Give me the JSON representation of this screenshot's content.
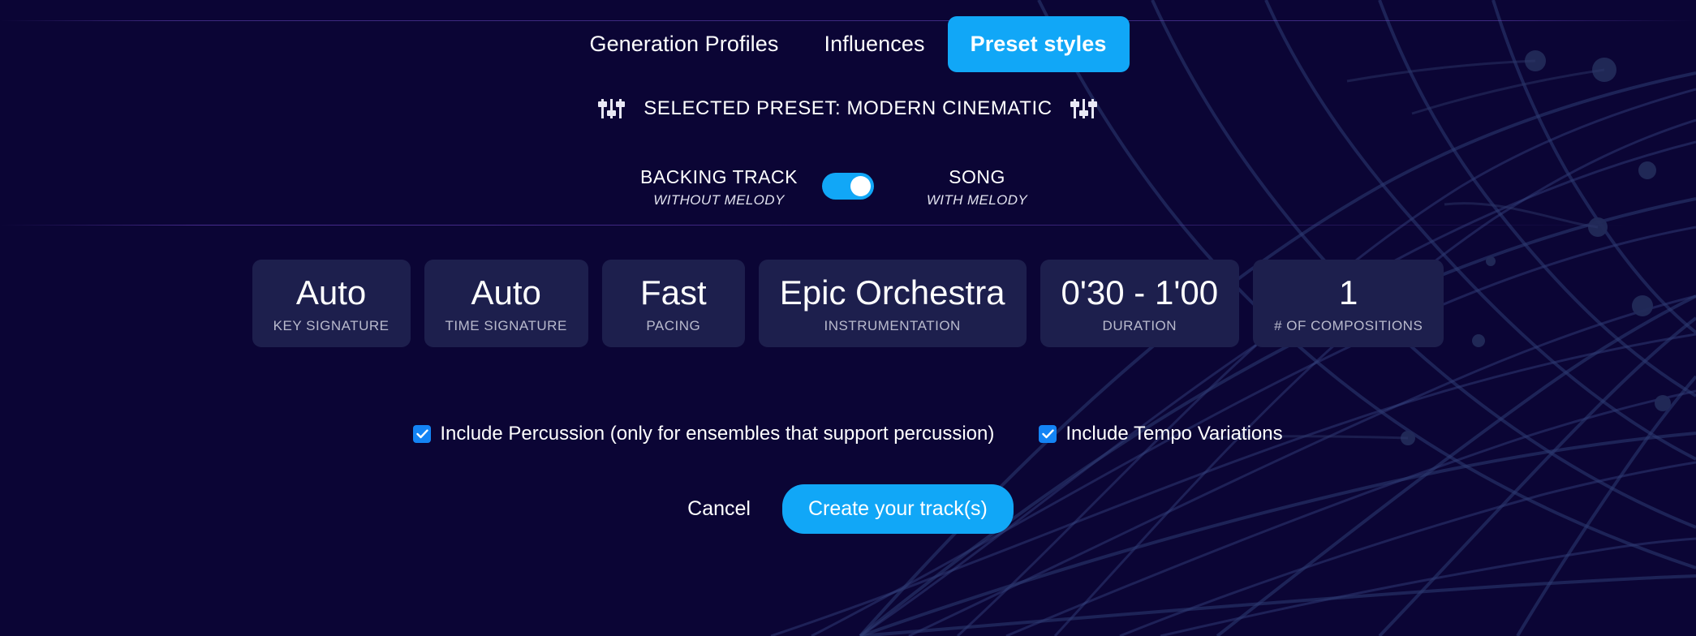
{
  "theme": {
    "background": "#0b0535",
    "accent": "#11a7f7",
    "card_background": "#1d1f4d",
    "muted_text": "#b9bacd",
    "checkbox_color": "#1484f5"
  },
  "tabs": [
    {
      "label": "Generation Profiles",
      "active": false
    },
    {
      "label": "Influences",
      "active": false
    },
    {
      "label": "Preset styles",
      "active": true
    }
  ],
  "preset_header": {
    "title": "SELECTED PRESET: MODERN CINEMATIC",
    "left_icon": "sliders-icon",
    "right_icon": "sliders-icon"
  },
  "mode_toggle": {
    "left_main": "BACKING TRACK",
    "left_sub": "WITHOUT MELODY",
    "right_main": "SONG",
    "right_sub": "WITH MELODY",
    "state": "on",
    "selected": "SONG"
  },
  "parameters": [
    {
      "value": "Auto",
      "label": "KEY SIGNATURE",
      "name": "key-signature"
    },
    {
      "value": "Auto",
      "label": "TIME SIGNATURE",
      "name": "time-signature"
    },
    {
      "value": "Fast",
      "label": "PACING",
      "name": "pacing"
    },
    {
      "value": "Epic Orchestra",
      "label": "INSTRUMENTATION",
      "name": "instrumentation"
    },
    {
      "value": "0'30 - 1'00",
      "label": "DURATION",
      "name": "duration"
    },
    {
      "value": "1",
      "label": "# OF COMPOSITIONS",
      "name": "compositions"
    }
  ],
  "checkboxes": [
    {
      "label": "Include Percussion (only for ensembles that support percussion)",
      "checked": true,
      "name": "include-percussion"
    },
    {
      "label": "Include Tempo Variations",
      "checked": true,
      "name": "include-tempo-variations"
    }
  ],
  "actions": {
    "cancel_label": "Cancel",
    "create_label": "Create your track(s)"
  }
}
